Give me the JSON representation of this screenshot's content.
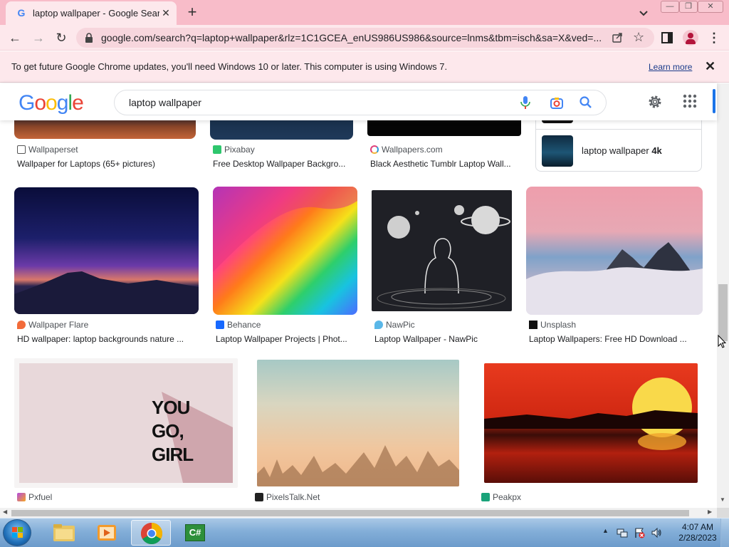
{
  "browser": {
    "tab_title": "laptop wallpaper - Google Search",
    "tab_favicon": "G",
    "new_tab": "+",
    "url": "google.com/search?q=laptop+wallpaper&rlz=1C1GCEA_enUS986US986&source=lnms&tbm=isch&sa=X&ved=...",
    "accent": "#f8bcc9"
  },
  "infobar": {
    "message": "To get future Google Chrome updates, you'll need Windows 10 or later. This computer is using Windows 7.",
    "learn_more": "Learn more"
  },
  "search": {
    "logo_letters": [
      "G",
      "o",
      "o",
      "g",
      "l",
      "e"
    ],
    "query": "laptop wallpaper"
  },
  "related": {
    "label_prefix": "laptop wallpaper",
    "label_bold": "4k"
  },
  "results": {
    "row0": [
      {
        "source": "Wallpaperset",
        "caption": "Wallpaper for Laptops (65+ pictures)"
      },
      {
        "source": "Pixabay",
        "caption": "Free Desktop Wallpaper Backgro..."
      },
      {
        "source": "Wallpapers.com",
        "caption": "Black Aesthetic Tumblr Laptop Wall..."
      }
    ],
    "row1": [
      {
        "source": "Wallpaper Flare",
        "caption": "HD wallpaper: laptop backgrounds nature ..."
      },
      {
        "source": "Behance",
        "caption": "Laptop Wallpaper Projects | Phot..."
      },
      {
        "source": "NawPic",
        "caption": "Laptop Wallpaper - NawPic"
      },
      {
        "source": "Unsplash",
        "caption": "Laptop Wallpapers: Free HD Download ..."
      }
    ],
    "row2": [
      {
        "source": "Pxfuel",
        "image_text": [
          "YOU",
          "GO,",
          "GIRL"
        ]
      },
      {
        "source": "PixelsTalk.Net"
      },
      {
        "source": "Peakpx"
      }
    ]
  },
  "taskbar": {
    "time": "4:07 AM",
    "date": "2/28/2023",
    "csharp_label": "C#"
  }
}
